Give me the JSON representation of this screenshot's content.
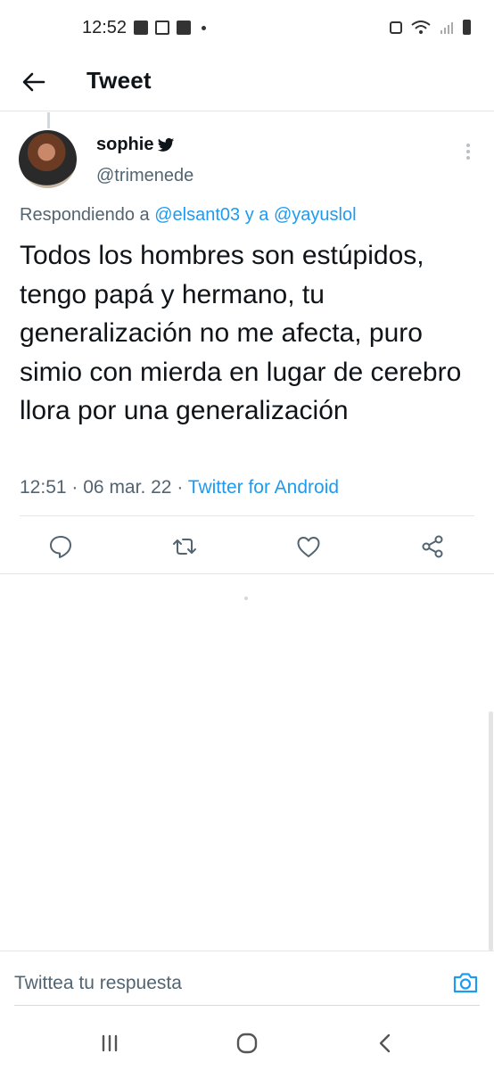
{
  "status_bar": {
    "time": "12:52"
  },
  "header": {
    "back_icon": "arrow-left-icon",
    "title": "Tweet"
  },
  "tweet": {
    "author": {
      "display_name": "sophie",
      "handle": "@trimenede",
      "avatar_icon": "avatar-photo",
      "badge_icon": "twitter-bird-icon"
    },
    "replying_prefix": "Respondiendo a",
    "replying_to": [
      "@elsant03",
      "@yayuslol"
    ],
    "replying_joiner": "y a",
    "text": "Todos los hombres son estúpidos, tengo papá y hermano, tu generalización no me afecta, puro simio con mierda en lugar de cerebro llora por una generalización",
    "time": "12:51",
    "date": "06 mar. 22",
    "separator": "·",
    "source": "Twitter for Android",
    "actions": [
      {
        "name": "reply",
        "icon": "reply-icon"
      },
      {
        "name": "retweet",
        "icon": "retweet-icon"
      },
      {
        "name": "like",
        "icon": "heart-icon"
      },
      {
        "name": "share",
        "icon": "share-icon"
      }
    ]
  },
  "reply_bar": {
    "placeholder": "Twittea tu respuesta",
    "camera_icon": "camera-icon"
  },
  "colors": {
    "accent": "#1d9bf0",
    "text_primary": "#0f1419",
    "text_secondary": "#536471"
  }
}
